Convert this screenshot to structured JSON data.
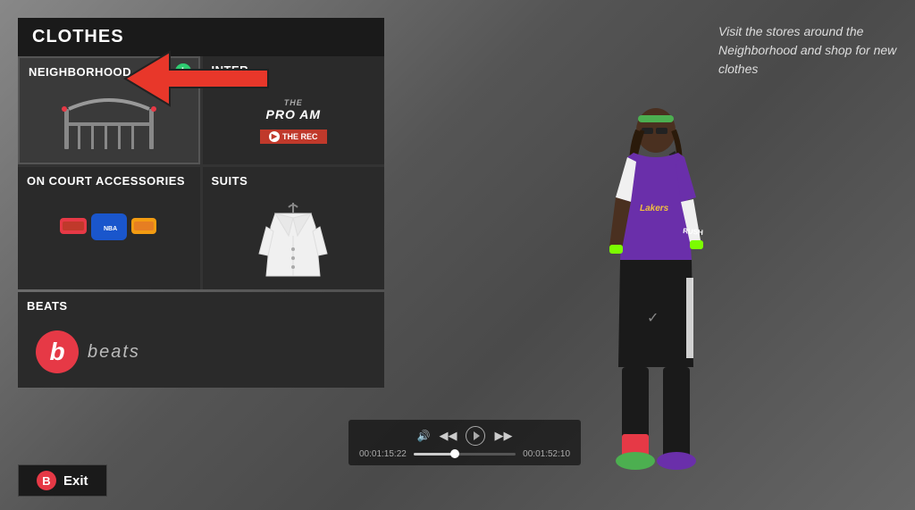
{
  "panel": {
    "title": "CLOTHES"
  },
  "menu_items": [
    {
      "id": "neighborhood",
      "label": "NEIGHBORHOOD",
      "col_span": 1,
      "has_notif": true,
      "selected": true
    },
    {
      "id": "pro_am_rec",
      "label": "INTER",
      "col_span": 1,
      "has_notif": false,
      "selected": false
    },
    {
      "id": "accessories",
      "label": "ON COURT ACCESSORIES",
      "col_span": 1,
      "has_notif": false,
      "selected": false
    },
    {
      "id": "suits",
      "label": "SUITS",
      "col_span": 1,
      "has_notif": false,
      "selected": false
    }
  ],
  "beats": {
    "section_label": "BEATS",
    "logo_text": "beats"
  },
  "exit_button": {
    "label": "Exit",
    "key": "B"
  },
  "description": "Visit the stores around the Neighborhood and shop for new clothes",
  "media_player": {
    "time_current": "00:01:15:22",
    "time_total": "00:01:52:10"
  },
  "colors": {
    "accent_red": "#e63946",
    "panel_bg": "#1e1e1e",
    "item_bg": "#2a2a2a",
    "text_primary": "#ffffff",
    "text_secondary": "#cccccc",
    "notif_green": "#2ecc71"
  }
}
